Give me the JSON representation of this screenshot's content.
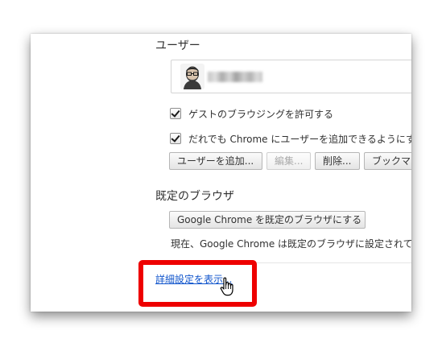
{
  "users_section": {
    "heading": "ユーザー",
    "guest_checkbox_label": "ゲストのブラウジングを許可する",
    "anyone_checkbox_label": "だれでも Chrome にユーザーを追加できるようにす",
    "add_user_button": "ユーザーを追加...",
    "edit_button": "編集...",
    "delete_button": "削除...",
    "bookmarks_button": "ブックマ"
  },
  "default_browser_section": {
    "heading": "既定のブラウザ",
    "make_default_button": "Google Chrome を既定のブラウザにする",
    "status_text": "現在、Google Chrome は既定のブラウザに設定されてい"
  },
  "advanced_link": "詳細設定を表示...",
  "colors": {
    "highlight": "#ee0000",
    "link": "#1155cc"
  },
  "icons": {
    "avatar": "user-avatar-portrait",
    "cursor": "hand-pointer-cursor"
  }
}
